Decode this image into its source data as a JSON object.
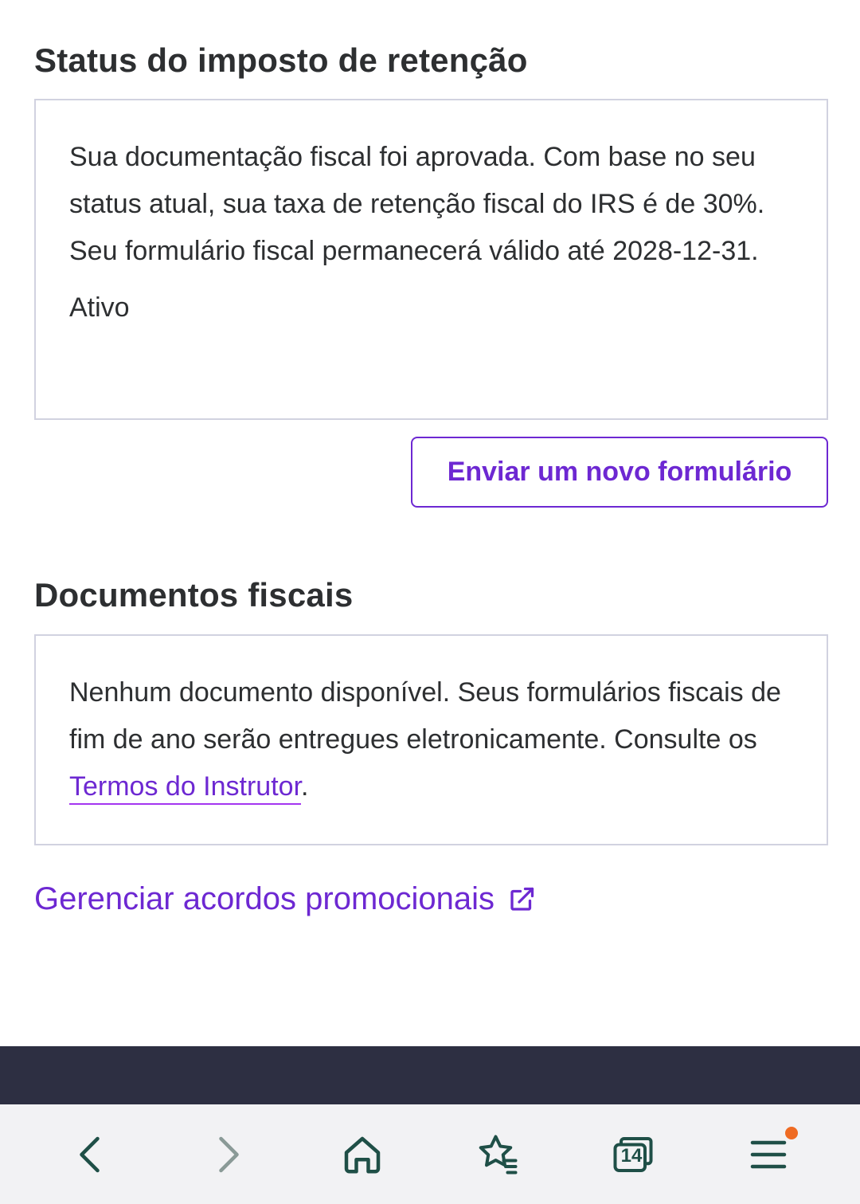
{
  "withholding": {
    "title": "Status do imposto de retenção",
    "message": "Sua documentação fiscal foi aprovada. Com base no seu status atual, sua taxa de retenção fiscal do IRS é de 30%. Seu formulário fiscal permanecerá válido até 2028-12-31.",
    "status": "Ativo",
    "submit_button": "Enviar um novo formulário"
  },
  "documents": {
    "title": "Documentos fiscais",
    "message_before_link": "Nenhum documento disponível. Seus formulários fiscais de fim de ano serão entregues eletronicamente. Consulte os ",
    "link_text": "Termos do Instrutor",
    "message_after_link": "."
  },
  "promo": {
    "link_text": "Gerenciar acordos promocionais",
    "icon": "external-link-icon"
  },
  "browser": {
    "tab_count": "14",
    "icons": [
      "back-icon",
      "forward-icon",
      "home-icon",
      "bookmarks-icon",
      "tabs-icon",
      "menu-icon"
    ],
    "menu_badge_color": "#ef6b23"
  },
  "colors": {
    "accent": "#6d28d2",
    "footer_band": "#2d2f42"
  }
}
